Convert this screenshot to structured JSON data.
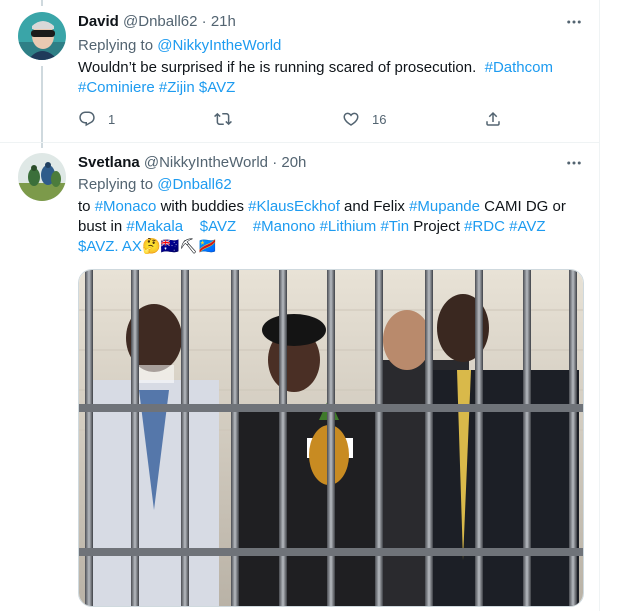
{
  "tweets": [
    {
      "display_name": "David",
      "handle": "@Dnball62",
      "dot": "·",
      "time": "21h",
      "replying_prefix": "Replying to ",
      "replying_to": "@NikkyIntheWorld",
      "text": [
        {
          "t": "Wouldn’t be surprised if he is running scared of prosecution.  ",
          "link": false
        },
        {
          "t": "#Dathcom",
          "link": true
        },
        {
          "t": " ",
          "link": false
        },
        {
          "t": "#Cominiere",
          "link": true
        },
        {
          "t": " ",
          "link": false
        },
        {
          "t": "#Zijin",
          "link": true
        },
        {
          "t": " ",
          "link": false
        },
        {
          "t": "$AVZ",
          "link": true
        }
      ],
      "reply_count": "1",
      "retweet_count": "",
      "like_count": "16"
    },
    {
      "display_name": "Svetlana",
      "handle": "@NikkyIntheWorld",
      "dot": "·",
      "time": "20h",
      "replying_prefix": "Replying to ",
      "replying_to": "@Dnball62",
      "text": [
        {
          "t": "to ",
          "link": false
        },
        {
          "t": "#Monaco",
          "link": true
        },
        {
          "t": " with buddies ",
          "link": false
        },
        {
          "t": "#KlausEckhof",
          "link": true
        },
        {
          "t": " and Felix ",
          "link": false
        },
        {
          "t": "#Mupande",
          "link": true
        },
        {
          "t": " CAMI DG or bust in ",
          "link": false
        },
        {
          "t": "#Makala",
          "link": true
        },
        {
          "t": "    ",
          "link": false
        },
        {
          "t": "$AVZ",
          "link": true
        },
        {
          "t": "    ",
          "link": false
        },
        {
          "t": "#Manono",
          "link": true
        },
        {
          "t": " ",
          "link": false
        },
        {
          "t": "#Lithium",
          "link": true
        },
        {
          "t": " ",
          "link": false
        },
        {
          "t": "#Tin",
          "link": true
        },
        {
          "t": " Project ",
          "link": false
        },
        {
          "t": "#RDC",
          "link": true
        },
        {
          "t": " ",
          "link": false
        },
        {
          "t": "#AVZ",
          "link": true
        },
        {
          "t": " ",
          "link": false
        },
        {
          "t": "$AVZ",
          "link": true
        },
        {
          "t": ". AX",
          "link": true
        },
        {
          "t": "🤔🇦🇺⛏🇨🇩",
          "link": false
        }
      ],
      "media_icon": "jail-photo"
    }
  ],
  "icons": {
    "more": "more-icon",
    "reply": "reply-icon",
    "retweet": "retweet-icon",
    "like": "like-icon",
    "share": "share-icon"
  },
  "colors": {
    "accent": "#1d9bf0",
    "secondary_text": "#536471",
    "primary_text": "#0f1419",
    "border": "#eff3f4"
  }
}
